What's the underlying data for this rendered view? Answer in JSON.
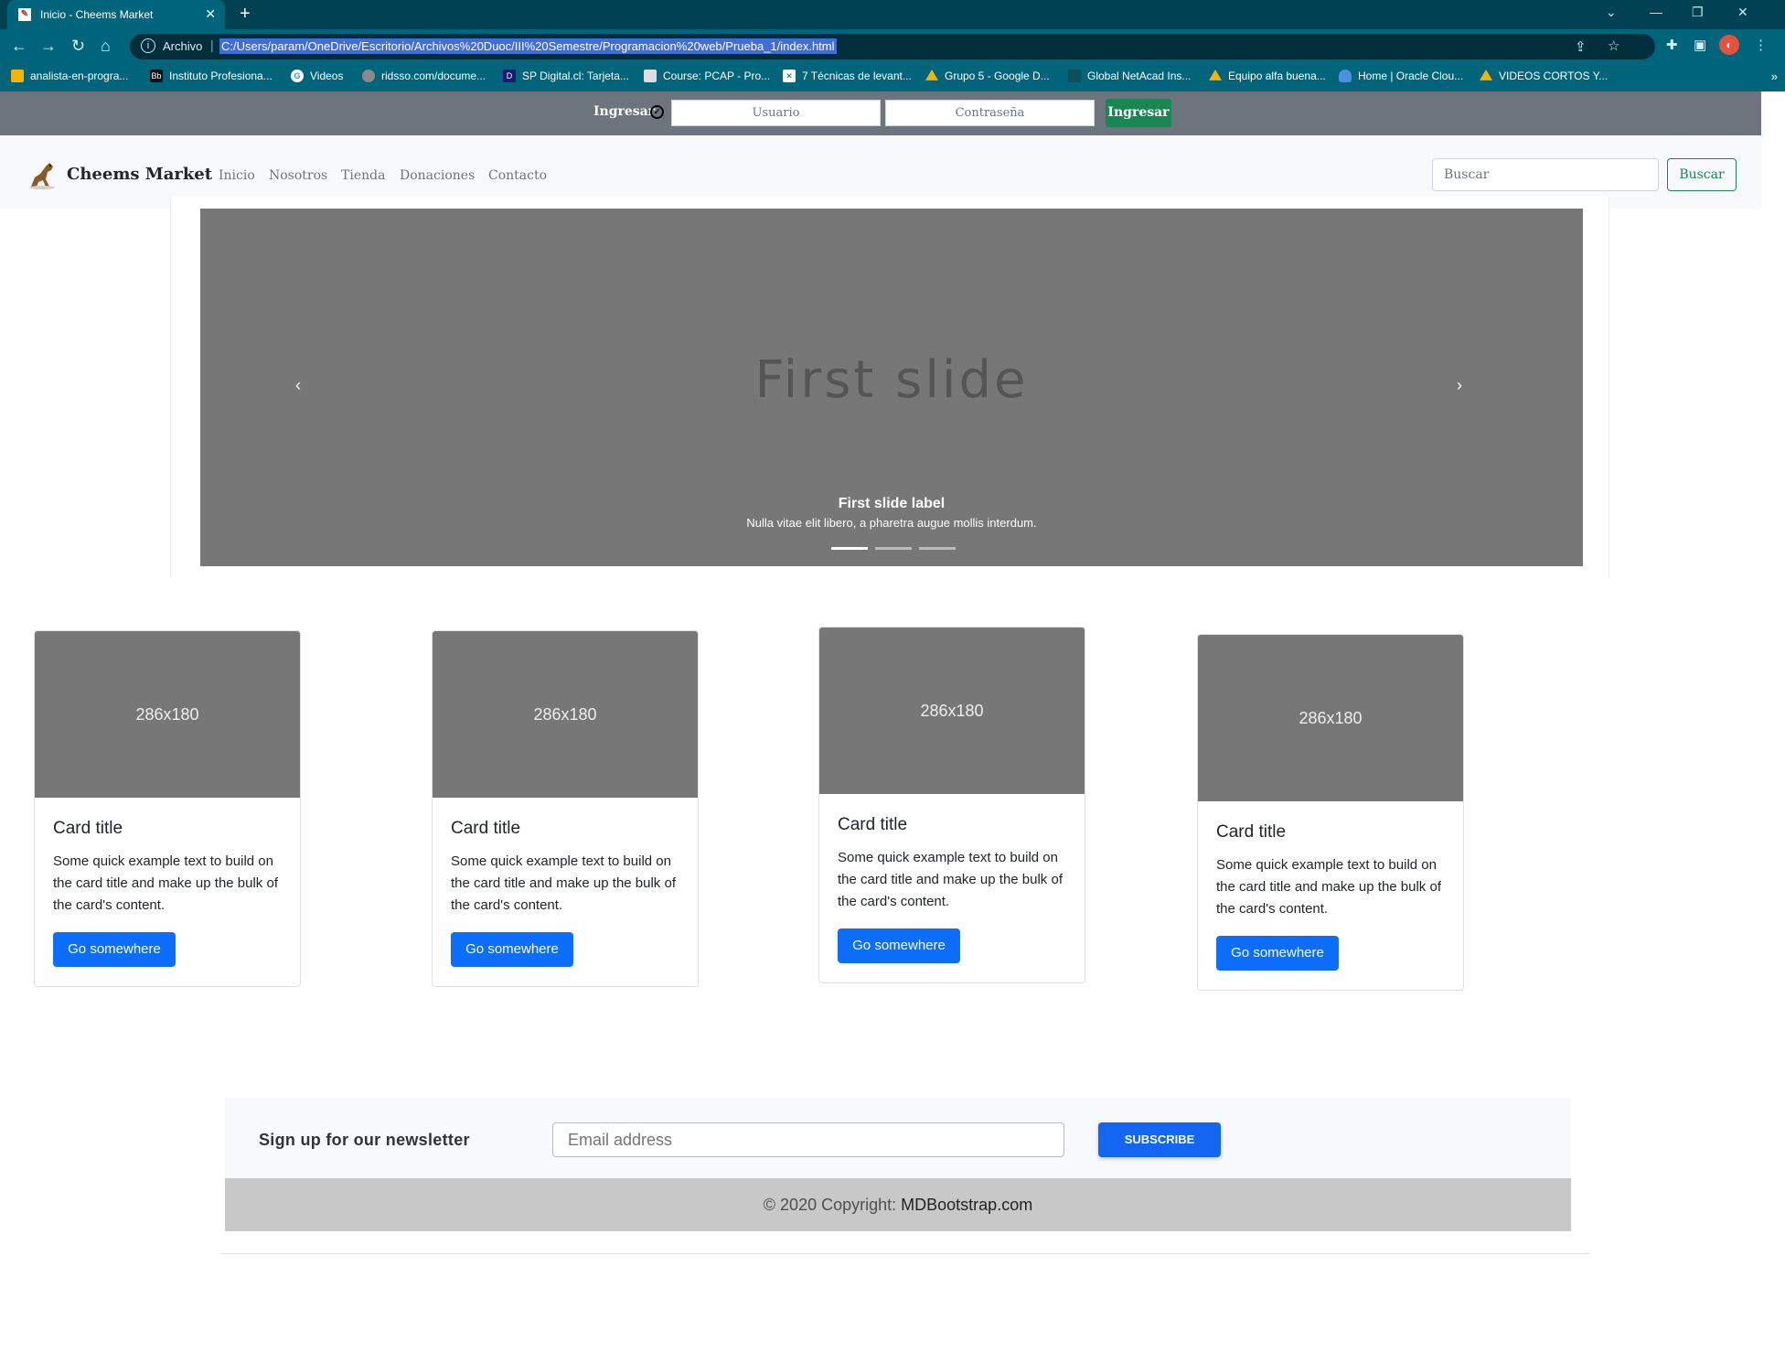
{
  "browser": {
    "tab_title": "Inicio - Cheems Market",
    "new_tab_label": "+",
    "address_scheme": "Archivo",
    "address_url": "C:/Users/param/OneDrive/Escritorio/Archivos%20Duoc/III%20Semestre/Programacion%20web/Prueba_1/index.html",
    "bookmarks": [
      {
        "label": "analista-en-progra...",
        "icon": "bookmark-icon",
        "color": "#f5b400"
      },
      {
        "label": "Instituto Profesiona...",
        "icon": "blackboard-icon",
        "color": "#111111",
        "glyph": "Bb"
      },
      {
        "label": "Videos",
        "icon": "google-icon",
        "color": "#ffffff",
        "glyph": "G"
      },
      {
        "label": "ridsso.com/docume...",
        "icon": "globe-icon",
        "color": "#8a8a8a"
      },
      {
        "label": "SP Digital.cl: Tarjeta...",
        "icon": "spdigital-icon",
        "color": "#1a1a6e"
      },
      {
        "label": "Course: PCAP - Pro...",
        "icon": "course-icon",
        "color": "#dddddd"
      },
      {
        "label": "7 Técnicas de levant...",
        "icon": "puzzle-icon",
        "color": "#ffffff"
      },
      {
        "label": "Grupo 5 - Google D...",
        "icon": "google-drive-icon",
        "color": "#f5b400"
      },
      {
        "label": "Global NetAcad Ins...",
        "icon": "netacad-icon",
        "color": "#0f4c5c"
      },
      {
        "label": "Equipo alfa buena...",
        "icon": "google-drive-icon",
        "color": "#f5b400"
      },
      {
        "label": "Home | Oracle Clou...",
        "icon": "cloud-icon",
        "color": "#4a8fe0"
      },
      {
        "label": "VIDEOS CORTOS Y...",
        "icon": "google-drive-icon",
        "color": "#f5b400"
      }
    ]
  },
  "login": {
    "label": "Ingresar",
    "user_placeholder": "Usuario",
    "password_placeholder": "Contraseña",
    "button": "Ingresar"
  },
  "navbar": {
    "brand": "Cheems Market",
    "links": [
      "Inicio",
      "Nosotros",
      "Tienda",
      "Donaciones",
      "Contacto"
    ],
    "search_placeholder": "Buscar",
    "search_button": "Buscar"
  },
  "carousel": {
    "slide_text": "First slide",
    "caption_title": "First slide label",
    "caption_text": "Nulla vitae elit libero, a pharetra augue mollis interdum.",
    "prev": "‹",
    "next": "›",
    "slide_count": 3,
    "active_index": 0
  },
  "cards": [
    {
      "image": "286x180",
      "title": "Card title",
      "text": "Some quick example text to build on the card title and make up the bulk of the card's content.",
      "button": "Go somewhere"
    },
    {
      "image": "286x180",
      "title": "Card title",
      "text": "Some quick example text to build on the card title and make up the bulk of the card's content.",
      "button": "Go somewhere"
    },
    {
      "image": "286x180",
      "title": "Card title",
      "text": "Some quick example text to build on the card title and make up the bulk of the card's content.",
      "button": "Go somewhere"
    },
    {
      "image": "286x180",
      "title": "Card title",
      "text": "Some quick example text to build on the card title and make up the bulk of the card's content.",
      "button": "Go somewhere"
    }
  ],
  "newsletter": {
    "label": "Sign up for our newsletter",
    "email_placeholder": "Email address",
    "button": "SUBSCRIBE"
  },
  "footer": {
    "copyright_prefix": "© 2020 Copyright:",
    "copyright_site": "MDBootstrap.com"
  },
  "colors": {
    "browser_dark": "#004152",
    "browser_toolbar": "#00657a",
    "login_bar": "#6c757d",
    "success": "#198754",
    "primary": "#0d6efd",
    "placeholder_gray": "#777777"
  }
}
